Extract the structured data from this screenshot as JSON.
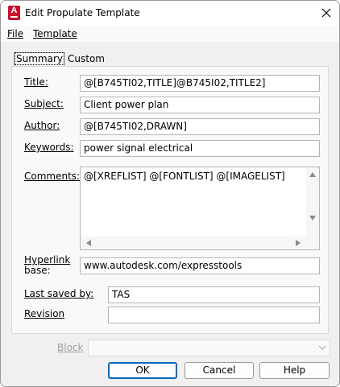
{
  "window": {
    "title": "Edit Propulate Template"
  },
  "app_icon": {
    "letter": "A",
    "color": "#c8102e"
  },
  "menu": {
    "file": "File",
    "template": "Template"
  },
  "tabs": {
    "summary": "Summary",
    "custom": "Custom"
  },
  "fields": {
    "title": {
      "label": "Title:",
      "value": "@[B745TI02,TITLE]@B745I02,TITLE2]"
    },
    "subject": {
      "label": "Subject:",
      "value": "Client power plan"
    },
    "author": {
      "label": "Author:",
      "value": "@[B745TI02,DRAWN]"
    },
    "keywords": {
      "label": "Keywords:",
      "value": "power signal electrical"
    },
    "comments": {
      "label": "Comments:",
      "value": "@[XREFLIST] @[FONTLIST] @[IMAGELIST]"
    },
    "hyperlink_base": {
      "label_line1": "Hyperlink",
      "label_line2": "base:",
      "value": "www.autodesk.com/expresstools"
    },
    "last_saved_by": {
      "label": "Last saved by:",
      "value": "TAS"
    },
    "revision": {
      "label": "Revision",
      "value": ""
    }
  },
  "block": {
    "label": "Block",
    "value": ""
  },
  "buttons": {
    "ok": "OK",
    "cancel": "Cancel",
    "help": "Help"
  }
}
